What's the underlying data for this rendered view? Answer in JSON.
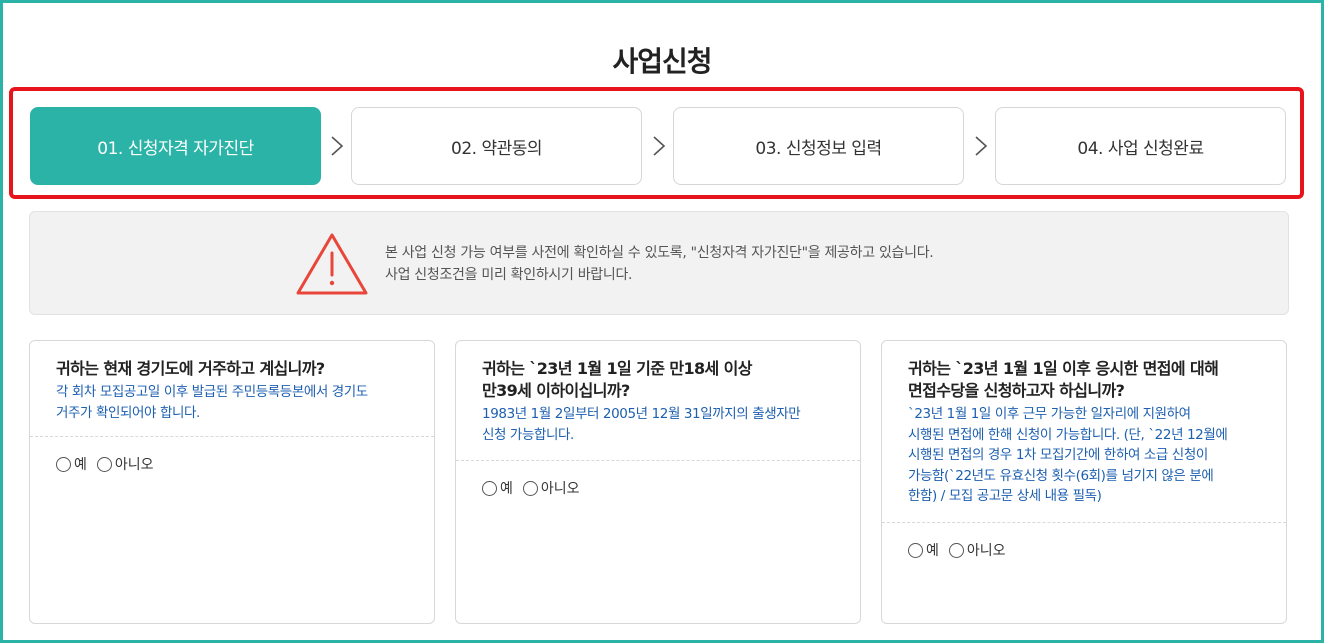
{
  "page": {
    "title": "사업신청"
  },
  "steps": [
    {
      "label": "01. 신청자격 자가진단",
      "active": true
    },
    {
      "label": "02. 약관동의",
      "active": false
    },
    {
      "label": "03. 신청정보 입력",
      "active": false
    },
    {
      "label": "04. 사업 신청완료",
      "active": false
    }
  ],
  "notice": {
    "icon": "warning-triangle-icon",
    "line1": "본 사업 신청 가능 여부를 사전에 확인하실 수 있도록, \"신청자격 자가진단\"을 제공하고 있습니다.",
    "line2": "사업 신청조건을 미리 확인하시기 바랍니다."
  },
  "questions": [
    {
      "question": [
        "귀하는 현재 경기도에 거주하고 계십니까?"
      ],
      "description": [
        "각 회차 모집공고일 이후 발급된 주민등록등본에서 경기도",
        "거주가 확인되어야 합니다."
      ],
      "options": [
        "예",
        "아니오"
      ]
    },
    {
      "question": [
        "귀하는 `23년 1월 1일 기준 만18세 이상",
        "만39세 이하이십니까?"
      ],
      "description": [
        "1983년 1월 2일부터 2005년 12월 31일까지의 출생자만",
        "신청 가능합니다."
      ],
      "options": [
        "예",
        "아니오"
      ]
    },
    {
      "question": [
        "귀하는 `23년 1월 1일 이후 응시한 면접에 대해",
        "면접수당을 신청하고자 하십니까?"
      ],
      "description": [
        "`23년 1월 1일 이후 근무 가능한 일자리에 지원하여",
        "시행된 면접에 한해 신청이 가능합니다. (단, `22년 12월에",
        "시행된 면접의 경우 1차 모집기간에 한하여 소급 신청이",
        "가능함(`22년도 유효신청 횟수(6회)를 넘기지 않은 분에",
        "한함) / 모집 공고문 상세 내용 필독)"
      ],
      "options": [
        "예",
        "아니오"
      ]
    }
  ],
  "colors": {
    "accent": "#2ab3a6",
    "highlight": "#e8141b",
    "description": "#1d5fb0",
    "warning": "#e8463a"
  }
}
